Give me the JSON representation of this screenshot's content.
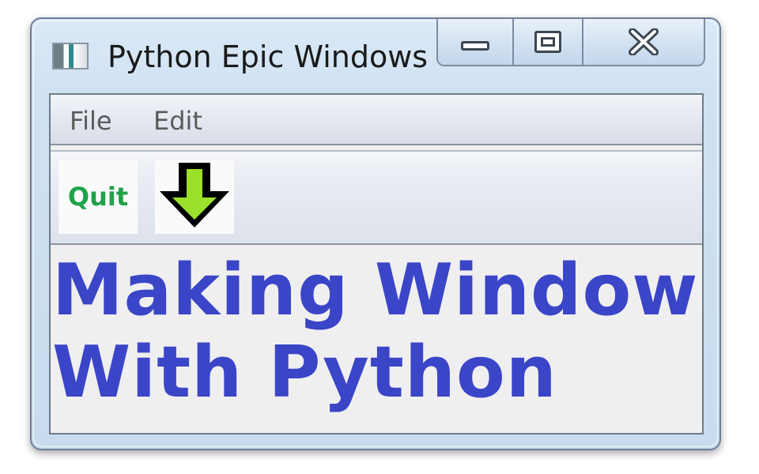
{
  "window": {
    "title": "Python Epic Windows",
    "icon": "app-window-icon"
  },
  "caption_buttons": {
    "minimize_icon": "minimize-icon",
    "maximize_icon": "maximize-icon",
    "close_icon": "close-icon"
  },
  "menubar": {
    "items": [
      {
        "label": "File"
      },
      {
        "label": "Edit"
      }
    ]
  },
  "toolbar": {
    "quit_label": "Quit",
    "arrow_icon": "down-arrow-icon"
  },
  "content": {
    "line1": "Making Windows",
    "line2": "With Python"
  },
  "colors": {
    "quit_text": "#1fa24a",
    "headline_text": "#3a45c8",
    "arrow_fill": "#9be02a",
    "arrow_outline": "#000000"
  }
}
